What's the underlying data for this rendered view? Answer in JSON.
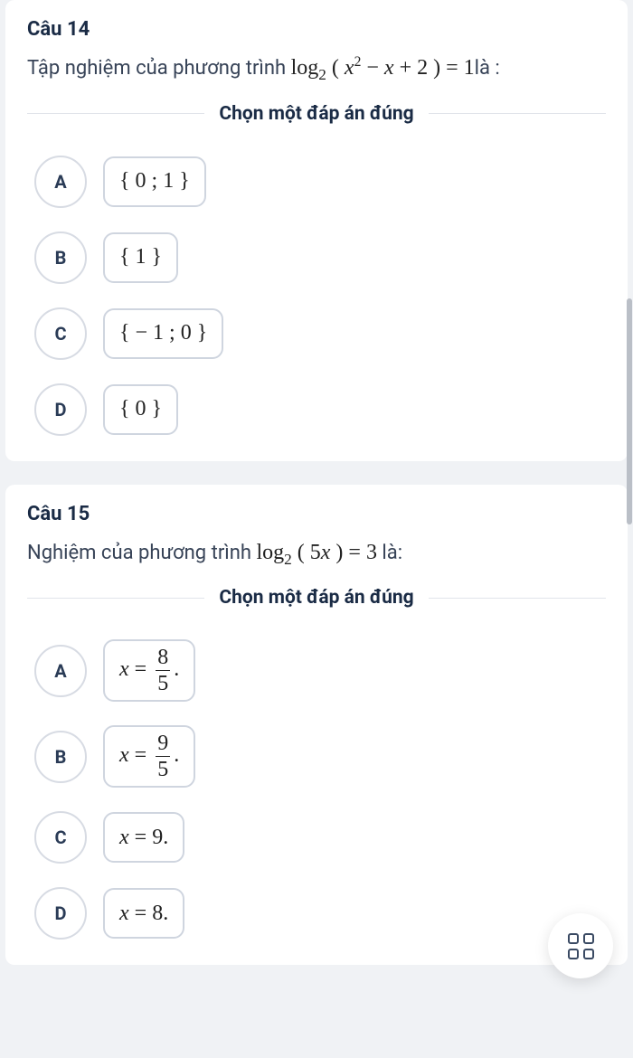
{
  "questions": [
    {
      "number": "Câu 14",
      "prompt_pre": "Tập nghiệm của phương trình ",
      "prompt_math": "log<sub>2</sub> ( <i>x</i><sup>2</sup> − <i>x</i> + 2 ) = 1",
      "prompt_post": "là :",
      "instruction": "Chọn một đáp án đúng",
      "options": [
        {
          "letter": "A",
          "math": "{ 0 ; 1 }"
        },
        {
          "letter": "B",
          "math": "{ 1 }"
        },
        {
          "letter": "C",
          "math": "{ − 1 ; 0 }"
        },
        {
          "letter": "D",
          "math": "{ 0 }"
        }
      ]
    },
    {
      "number": "Câu 15",
      "prompt_pre": "Nghiệm của phương trình ",
      "prompt_math": "log<sub>2</sub> ( 5<i>x</i> ) = 3",
      "prompt_post": " là:",
      "instruction": "Chọn một đáp án đúng",
      "options": [
        {
          "letter": "A",
          "math_html": "<i>x</i> = <span class=\"frac\"><span class=\"num\">8</span><span class=\"den\">5</span></span>."
        },
        {
          "letter": "B",
          "math_html": "<i>x</i> = <span class=\"frac\"><span class=\"num\">9</span><span class=\"den\">5</span></span>."
        },
        {
          "letter": "C",
          "math": "x = 9.",
          "math_html": "<i>x</i> = 9."
        },
        {
          "letter": "D",
          "math": "x = 8.",
          "math_html": "<i>x</i> = 8."
        }
      ]
    }
  ]
}
